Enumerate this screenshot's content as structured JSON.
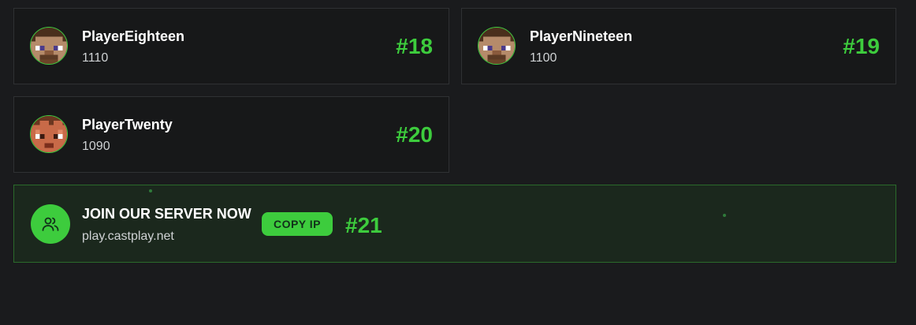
{
  "players": [
    {
      "name": "PlayerEighteen",
      "score": "1110",
      "rank": "#18",
      "skin": "brown-steve"
    },
    {
      "name": "PlayerNineteen",
      "score": "1100",
      "rank": "#19",
      "skin": "brown-steve"
    },
    {
      "name": "PlayerTwenty",
      "score": "1090",
      "rank": "#20",
      "skin": "orange-skin"
    }
  ],
  "join": {
    "title": "JOIN OUR SERVER NOW",
    "ip": "play.castplay.net",
    "copy_label": "COPY IP",
    "rank": "#21",
    "icon": "users-icon"
  },
  "colors": {
    "accent": "#3dcc3d",
    "background": "#1a1b1d",
    "card": "#171819",
    "join_card": "#1b281d"
  }
}
